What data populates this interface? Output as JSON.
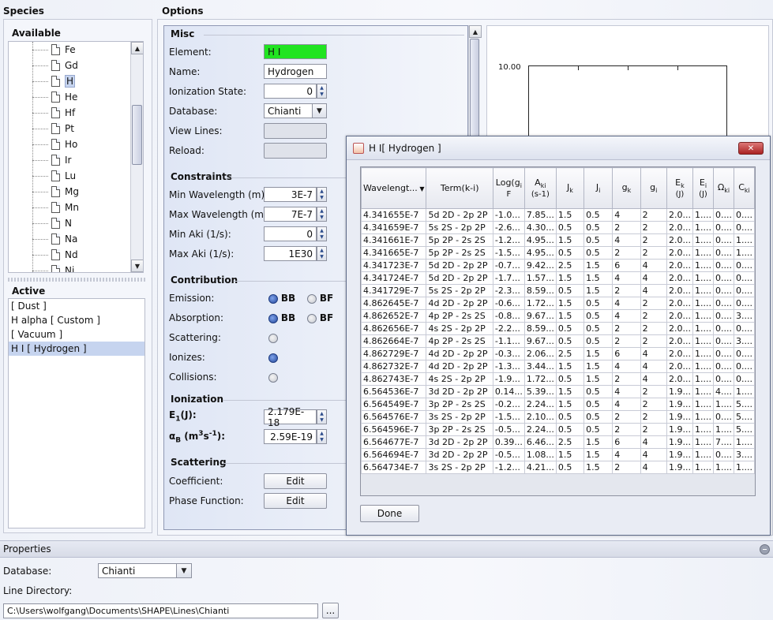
{
  "species": {
    "title": "Species",
    "available_title": "Available",
    "available_items": [
      "Fe",
      "Gd",
      "H",
      "He",
      "Hf",
      "Pt",
      "Ho",
      "Ir",
      "Lu",
      "Mg",
      "Mn",
      "N",
      "Na",
      "Nd",
      "Ni"
    ],
    "selected_available": "H",
    "active_title": "Active",
    "active_items": [
      "[ Dust ]",
      "H alpha [ Custom ]",
      "[ Vacuum ]",
      "H I [ Hydrogen ]"
    ],
    "selected_active": "H I [ Hydrogen ]"
  },
  "options": {
    "title": "Options",
    "misc": {
      "title": "Misc",
      "element_label": "Element:",
      "element_value": "H I",
      "name_label": "Name:",
      "name_value": "Hydrogen",
      "ionization_label": "Ionization State:",
      "ionization_value": "0",
      "database_label": "Database:",
      "database_value": "Chianti",
      "view_lines_label": "View Lines:",
      "reload_label": "Reload:"
    },
    "constraints": {
      "title": "Constraints",
      "min_wl_label": "Min Wavelength (m):",
      "min_wl_value": "3E-7",
      "max_wl_label": "Max Wavelength (m):",
      "max_wl_value": "7E-7",
      "min_aki_label": "Min Aki (1/s):",
      "min_aki_value": "0",
      "max_aki_label": "Max Aki (1/s):",
      "max_aki_value": "1E30"
    },
    "contribution": {
      "title": "Contribution",
      "emission_label": "Emission:",
      "absorption_label": "Absorption:",
      "scattering_label": "Scattering:",
      "ionizes_label": "Ionizes:",
      "collisions_label": "Collisions:",
      "bb": "BB",
      "bf": "BF"
    },
    "ionization": {
      "title": "Ionization",
      "e1_label_main": "E",
      "e1_label_sub": "1",
      "e1_label_tail": "(J):",
      "e1_value": "2.179E-18",
      "alpha_label_main": "α",
      "alpha_label_sub": "B",
      "alpha_label_tail": " (m",
      "alpha_label_sup1": "3",
      "alpha_label_mid": "s",
      "alpha_label_sup2": "-1",
      "alpha_label_end": "):",
      "alpha_value": "2.59E-19"
    },
    "scattering": {
      "title": "Scattering",
      "coefficient_label": "Coefficient:",
      "phase_label": "Phase Function:",
      "edit": "Edit"
    }
  },
  "plot": {
    "y_tick": "10.00"
  },
  "dialog": {
    "title": "H I[ Hydrogen ]",
    "close": "✕",
    "done": "Done",
    "columns": [
      "Wavelengt...",
      "Term(k-i)",
      "Log(g",
      "A",
      "J",
      "J",
      "g",
      "g",
      "E",
      "E",
      "Ω",
      "C"
    ],
    "column_subs": [
      "",
      "",
      "i",
      "ki",
      "k",
      "i",
      "k",
      "i",
      "k",
      "i",
      "ki",
      "ki"
    ],
    "column_extra": [
      "",
      "",
      "F",
      "(s-1)",
      "",
      "",
      "",
      "",
      "(J)",
      "(J)",
      "",
      ""
    ],
    "rows": [
      [
        "4.341655E-7",
        "5d 2D - 2p 2P",
        "-1.0...",
        "7.85...",
        "1.5",
        "0.5",
        "4",
        "2",
        "2.0...",
        "1....",
        "0....",
        "0...."
      ],
      [
        "4.341659E-7",
        "5s 2S - 2p 2P",
        "-2.6...",
        "4.30...",
        "0.5",
        "0.5",
        "2",
        "2",
        "2.0...",
        "1....",
        "0....",
        "0...."
      ],
      [
        "4.341661E-7",
        "5p 2P - 2s 2S",
        "-1.2...",
        "4.95...",
        "1.5",
        "0.5",
        "4",
        "2",
        "2.0...",
        "1....",
        "0....",
        "1...."
      ],
      [
        "4.341665E-7",
        "5p 2P - 2s 2S",
        "-1.5...",
        "4.95...",
        "0.5",
        "0.5",
        "2",
        "2",
        "2.0...",
        "1....",
        "0....",
        "1...."
      ],
      [
        "4.341723E-7",
        "5d 2D - 2p 2P",
        "-0.7...",
        "9.42...",
        "2.5",
        "1.5",
        "6",
        "4",
        "2.0...",
        "1....",
        "0....",
        "0...."
      ],
      [
        "4.341724E-7",
        "5d 2D - 2p 2P",
        "-1.7...",
        "1.57...",
        "1.5",
        "1.5",
        "4",
        "4",
        "2.0...",
        "1....",
        "0....",
        "0...."
      ],
      [
        "4.341729E-7",
        "5s 2S - 2p 2P",
        "-2.3...",
        "8.59...",
        "0.5",
        "1.5",
        "2",
        "4",
        "2.0...",
        "1....",
        "0....",
        "0...."
      ],
      [
        "4.862645E-7",
        "4d 2D - 2p 2P",
        "-0.6...",
        "1.72...",
        "1.5",
        "0.5",
        "4",
        "2",
        "2.0...",
        "1....",
        "0....",
        "0...."
      ],
      [
        "4.862652E-7",
        "4p 2P - 2s 2S",
        "-0.8...",
        "9.67...",
        "1.5",
        "0.5",
        "4",
        "2",
        "2.0...",
        "1....",
        "0....",
        "3...."
      ],
      [
        "4.862656E-7",
        "4s 2S - 2p 2P",
        "-2.2...",
        "8.59...",
        "0.5",
        "0.5",
        "2",
        "2",
        "2.0...",
        "1....",
        "0....",
        "0...."
      ],
      [
        "4.862664E-7",
        "4p 2P - 2s 2S",
        "-1.1...",
        "9.67...",
        "0.5",
        "0.5",
        "2",
        "2",
        "2.0...",
        "1....",
        "0....",
        "3...."
      ],
      [
        "4.862729E-7",
        "4d 2D - 2p 2P",
        "-0.3...",
        "2.06...",
        "2.5",
        "1.5",
        "6",
        "4",
        "2.0...",
        "1....",
        "0....",
        "0...."
      ],
      [
        "4.862732E-7",
        "4d 2D - 2p 2P",
        "-1.3...",
        "3.44...",
        "1.5",
        "1.5",
        "4",
        "4",
        "2.0...",
        "1....",
        "0....",
        "0...."
      ],
      [
        "4.862743E-7",
        "4s 2S - 2p 2P",
        "-1.9...",
        "1.72...",
        "0.5",
        "1.5",
        "2",
        "4",
        "2.0...",
        "1....",
        "0....",
        "0...."
      ],
      [
        "6.564536E-7",
        "3d 2D - 2p 2P",
        "0.14...",
        "5.39...",
        "1.5",
        "0.5",
        "4",
        "2",
        "1.9...",
        "1....",
        "4....",
        "1...."
      ],
      [
        "6.564549E-7",
        "3p 2P - 2s 2S",
        "-0.2...",
        "2.24...",
        "1.5",
        "0.5",
        "4",
        "2",
        "1.9...",
        "1....",
        "1....",
        "5...."
      ],
      [
        "6.564576E-7",
        "3s 2S - 2p 2P",
        "-1.5...",
        "2.10...",
        "0.5",
        "0.5",
        "2",
        "2",
        "1.9...",
        "1....",
        "0....",
        "5...."
      ],
      [
        "6.564596E-7",
        "3p 2P - 2s 2S",
        "-0.5...",
        "2.24...",
        "0.5",
        "0.5",
        "2",
        "2",
        "1.9...",
        "1....",
        "1....",
        "5...."
      ],
      [
        "6.564677E-7",
        "3d 2D - 2p 2P",
        "0.39...",
        "6.46...",
        "2.5",
        "1.5",
        "6",
        "4",
        "1.9...",
        "1....",
        "7....",
        "1...."
      ],
      [
        "6.564694E-7",
        "3d 2D - 2p 2P",
        "-0.5...",
        "1.08...",
        "1.5",
        "1.5",
        "4",
        "4",
        "1.9...",
        "1....",
        "0....",
        "3...."
      ],
      [
        "6.564734E-7",
        "3s 2S - 2p 2P",
        "-1.2...",
        "4.21...",
        "0.5",
        "1.5",
        "2",
        "4",
        "1.9...",
        "1....",
        "1....",
        "1...."
      ]
    ]
  },
  "properties": {
    "title": "Properties",
    "database_label": "Database:",
    "database_value": "Chianti",
    "line_dir_label": "Line Directory:",
    "line_dir_value": "C:\\Users\\wolfgang\\Documents\\SHAPE\\Lines\\Chianti",
    "browse": "..."
  },
  "colors": {
    "element_bg": "#21e421",
    "selection": "#c6d4ef",
    "accent": "#23479b"
  }
}
